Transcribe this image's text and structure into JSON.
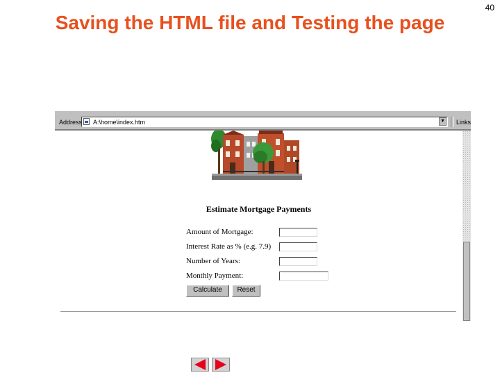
{
  "slide": {
    "title": "Saving the HTML file and Testing the page",
    "page_number": "40"
  },
  "browser": {
    "address_label": "Address",
    "address_value": "A:\\home\\index.htm",
    "links_label": "Links",
    "form": {
      "title": "Estimate Mortgage Payments",
      "fields": [
        {
          "label": "Amount of Mortgage:"
        },
        {
          "label": "Interest Rate as % (e.g. 7.9)"
        },
        {
          "label": "Number of Years:"
        },
        {
          "label": "Monthly Payment:"
        }
      ],
      "calculate_label": "Calculate",
      "reset_label": "Reset"
    }
  },
  "nav": {
    "prev_icon": "left-arrow-icon",
    "next_icon": "right-arrow-icon",
    "arrow_color": "#e8001c"
  },
  "colors": {
    "title": "#e8501e",
    "chrome": "#c0c0c0"
  }
}
